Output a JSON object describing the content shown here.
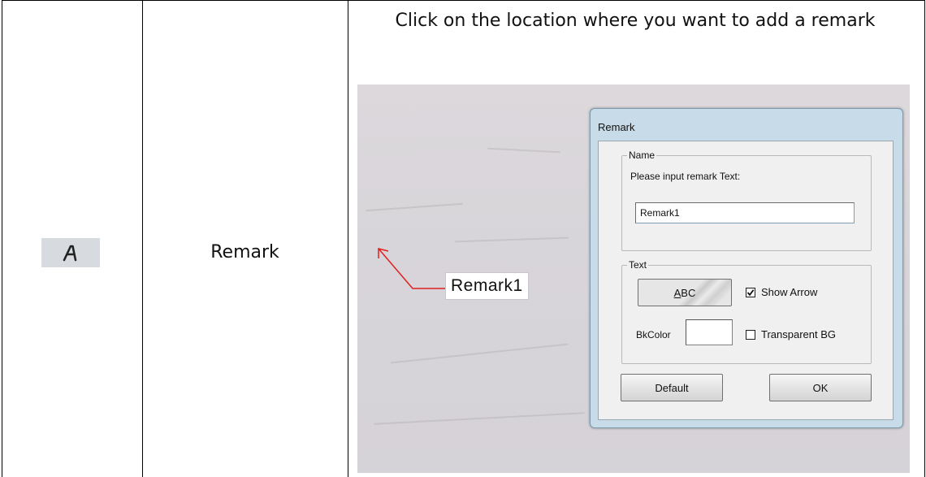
{
  "row": {
    "icon": "letter-a-remark-icon",
    "name": "Remark",
    "description": "Click on the location where you want to add a remark"
  },
  "screenshot": {
    "annotation_label": "Remark1",
    "dialog": {
      "title": "Remark",
      "name_group": {
        "legend": "Name",
        "prompt": "Please input remark Text:",
        "input_value": "Remark1"
      },
      "text_group": {
        "legend": "Text",
        "font_button_label": "ABC",
        "show_arrow_label": "Show Arrow",
        "show_arrow_checked": true,
        "bkcolor_label": "BkColor",
        "bkcolor_value": "#ffffff",
        "transparent_bg_label": "Transparent BG",
        "transparent_bg_checked": false
      },
      "default_button": "Default",
      "ok_button": "OK"
    }
  },
  "colors": {
    "arrow": "#e02020",
    "dialog_frame": "#c7dbe8",
    "icon_bg": "#d7dbe0"
  }
}
